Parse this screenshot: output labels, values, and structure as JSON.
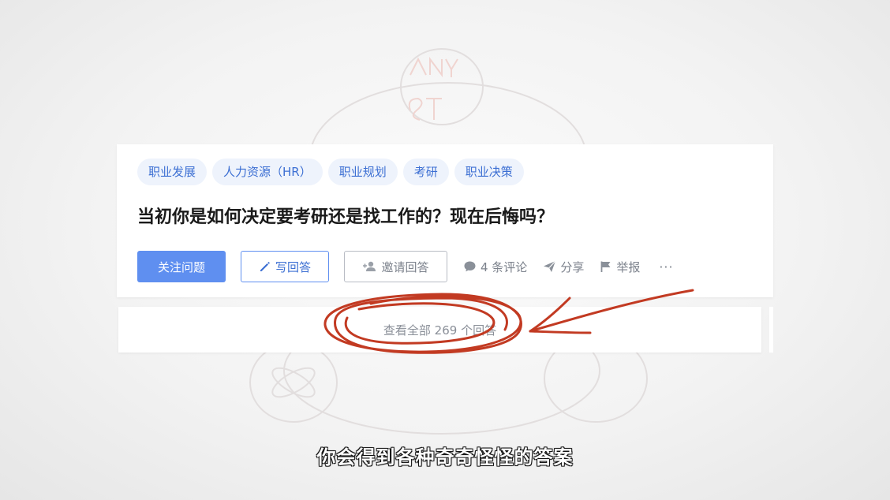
{
  "question": {
    "tags": [
      "职业发展",
      "人力资源（HR）",
      "职业规划",
      "考研",
      "职业决策"
    ],
    "title": "当初你是如何决定要考研还是找工作的？现在后悔吗？"
  },
  "actions": {
    "follow_label": "关注问题",
    "write_answer_label": "写回答",
    "invite_label": "邀请回答",
    "comments_label": "4 条评论",
    "share_label": "分享",
    "report_label": "举报",
    "more_label": "···"
  },
  "answers": {
    "view_all_label": "查看全部 269 个回答"
  },
  "subtitle": "你会得到各种奇奇怪怪的答案",
  "colors": {
    "accent": "#5f8ff0",
    "tag_bg": "#eef3fc",
    "annotation": "#c23a22"
  },
  "icons": [
    "pencil-icon",
    "add-user-icon",
    "comment-icon",
    "share-icon",
    "flag-icon",
    "more-icon"
  ]
}
